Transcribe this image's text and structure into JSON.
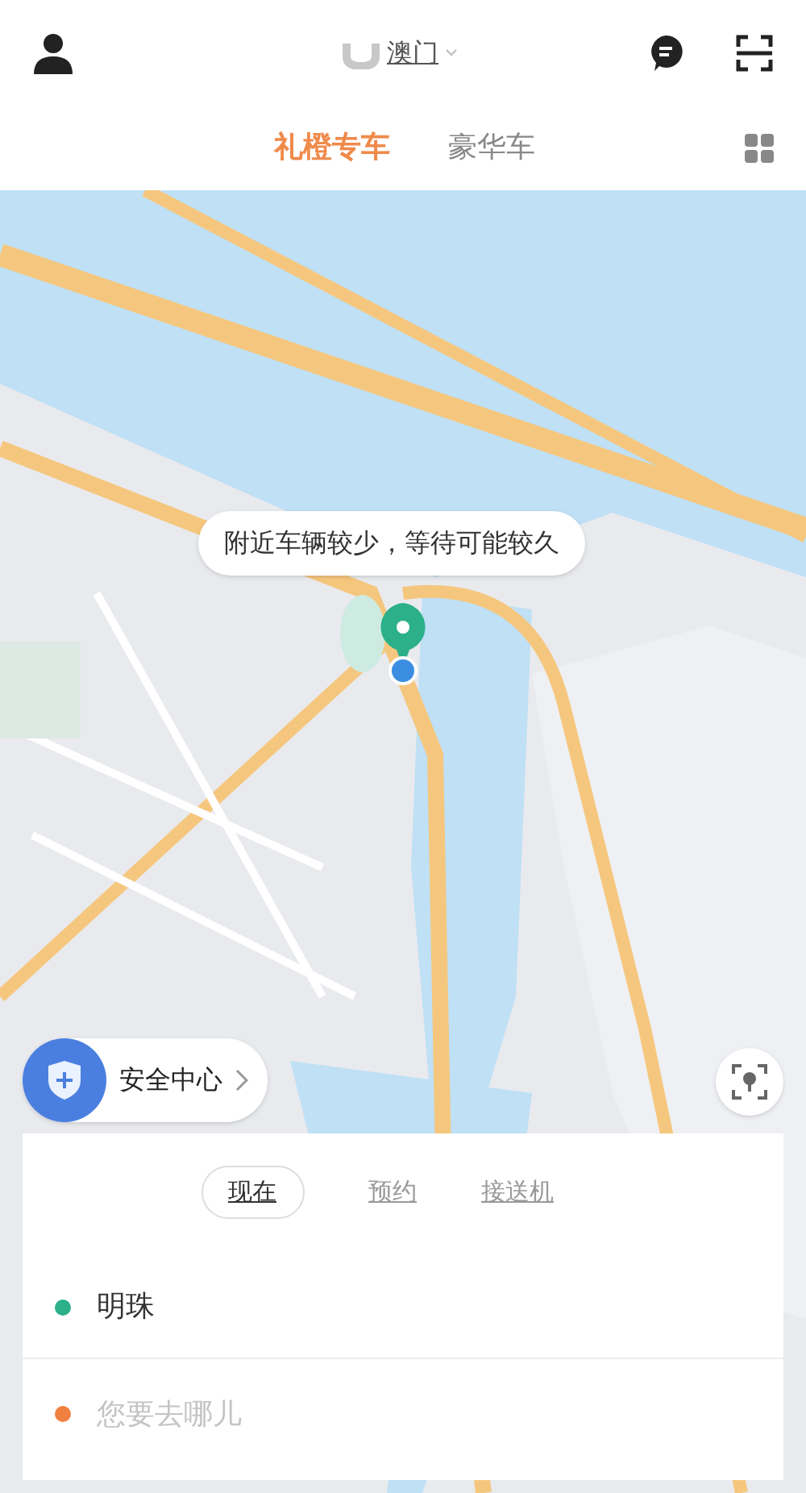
{
  "header": {
    "city": "澳门"
  },
  "car_tabs": [
    {
      "label": "礼橙专车",
      "selected": true
    },
    {
      "label": "豪华车",
      "selected": false
    }
  ],
  "map": {
    "notice": "附近车辆较少，等待可能较久"
  },
  "safety_center": {
    "label": "安全中心"
  },
  "time_tabs": [
    {
      "label": "现在",
      "selected": true
    },
    {
      "label": "预约",
      "selected": false
    },
    {
      "label": "接送机",
      "selected": false
    }
  ],
  "locations": [
    {
      "kind": "value",
      "value": "明珠",
      "color": "#2bb08a"
    },
    {
      "kind": "placeholder",
      "placeholder": "您要去哪儿",
      "color": "#f08040"
    }
  ]
}
